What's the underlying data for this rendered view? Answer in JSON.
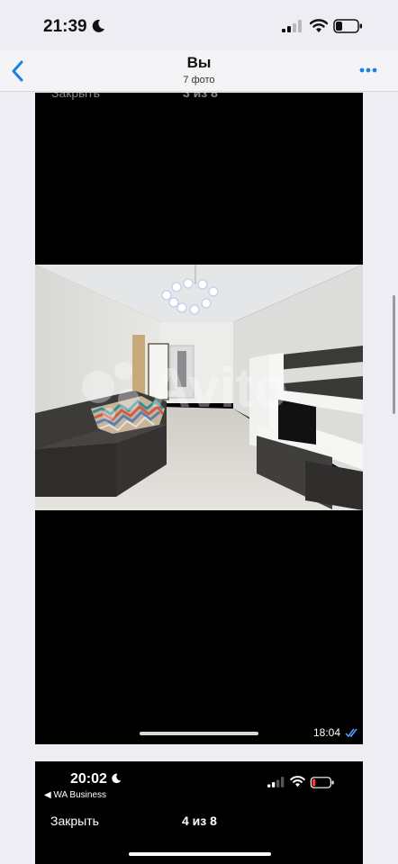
{
  "status_bar": {
    "time": "21:39",
    "icons": [
      "moon-icon",
      "signal-icon",
      "wifi-icon",
      "battery-icon"
    ]
  },
  "nav": {
    "back_icon": "chevron-left-icon",
    "title": "Вы",
    "subtitle": "7 фото",
    "more_icon": "ellipsis-icon",
    "accent_color": "#1a7fe6"
  },
  "messages": [
    {
      "ghost_close": "Закрыть",
      "ghost_count": "3 из 8",
      "time": "18:04",
      "read_icon": "double-check-icon",
      "read_color": "#4fa6ff"
    }
  ],
  "second_screenshot": {
    "time": "20:02",
    "back_label": "◀ WA Business",
    "close_label": "Закрыть",
    "counter": "4 из 8",
    "battery_color": "#ff3b30"
  },
  "photo": {
    "watermark": "Avito"
  }
}
